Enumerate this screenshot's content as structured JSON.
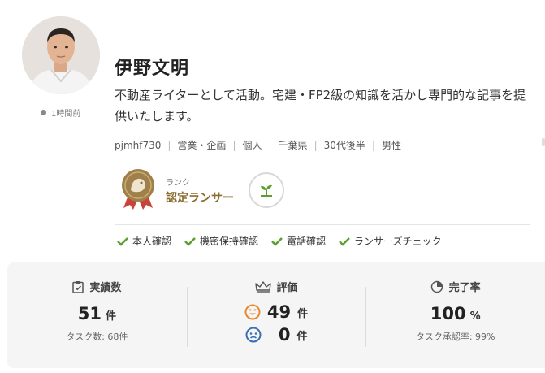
{
  "profile": {
    "name": "伊野文明",
    "bio": "不動産ライターとして活動。宅建・FP2級の知識を活かし専門的な記事を提供いたします。",
    "status": "1時間前",
    "meta": {
      "user_id": "pjmhf730",
      "category": "営業・企画",
      "type": "個人",
      "location": "千葉県",
      "age": "30代後半",
      "gender": "男性"
    }
  },
  "rank": {
    "label": "ランク",
    "value": "認定ランサー"
  },
  "verifications": [
    "本人確認",
    "機密保持確認",
    "電話確認",
    "ランサーズチェック"
  ],
  "stats": {
    "achievements": {
      "title": "実績数",
      "value": "51",
      "unit": "件",
      "sub": "タスク数: 68件"
    },
    "ratings": {
      "title": "評価",
      "good": "49",
      "bad": "0",
      "unit": "件"
    },
    "completion": {
      "title": "完了率",
      "value": "100",
      "unit": "%",
      "sub": "タスク承認率: 99%"
    }
  },
  "colors": {
    "check": "#5aa02c",
    "rank_gold": "#a0804a",
    "rank_red": "#c8433a",
    "good_face": "#e8872c",
    "bad_face": "#3a6fb5"
  }
}
